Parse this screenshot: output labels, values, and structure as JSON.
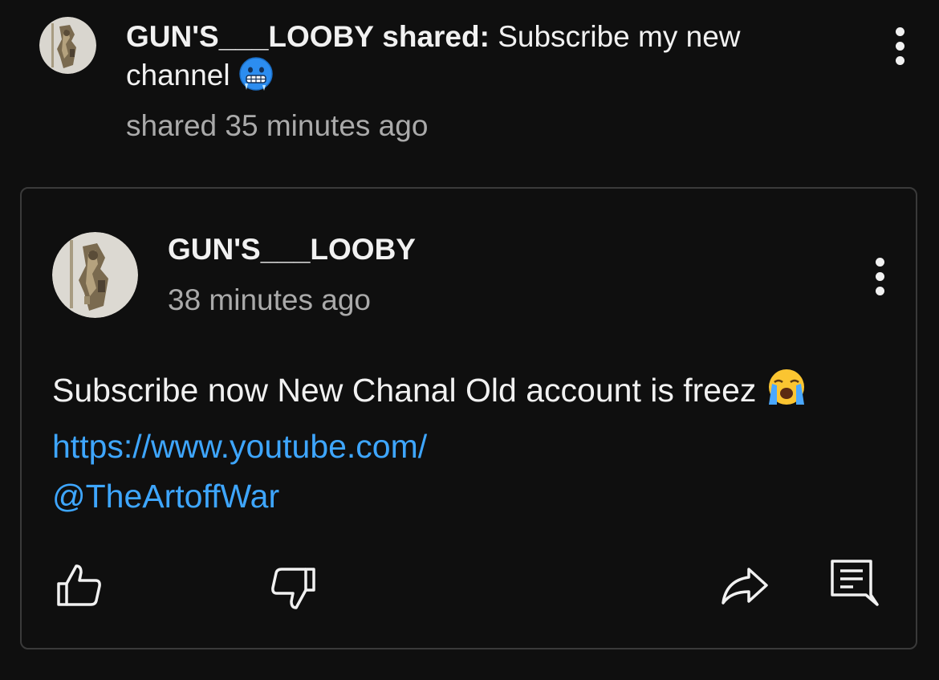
{
  "outer": {
    "author": "GUN'S___LOOBY",
    "action_label": "shared:",
    "text": "Subscribe my new channel",
    "emoji": "cold-face-emoji",
    "time": "shared 35 minutes ago"
  },
  "card": {
    "author": "GUN'S___LOOBY",
    "time": "38 minutes ago",
    "body_text": "Subscribe now New Chanal Old account is freez",
    "body_emoji": "loudly-crying-face-emoji",
    "link_line1": "https://www.youtube.com/",
    "link_line2": "@TheArtoffWar"
  },
  "actions": {
    "like": "thumbs-up-icon",
    "dislike": "thumbs-down-icon",
    "share": "share-arrow-icon",
    "comment": "comment-icon"
  },
  "colors": {
    "background": "#0f0f0f",
    "text": "#f1f1f1",
    "secondary_text": "#aaaaaa",
    "link": "#3ea6ff",
    "card_border": "#3a3a3a"
  }
}
